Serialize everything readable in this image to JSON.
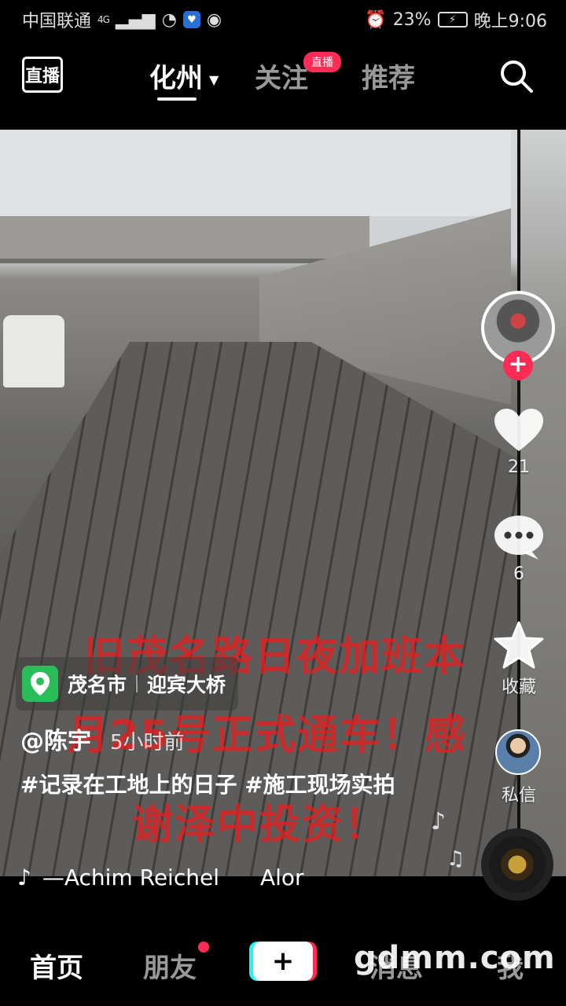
{
  "status_bar": {
    "carrier": "中国联通",
    "network": "4G",
    "battery": "23%",
    "time": "晚上9:06"
  },
  "top_nav": {
    "logo_label": "直播",
    "tabs": [
      {
        "label": "化州",
        "active": true
      },
      {
        "label": "关注",
        "active": false,
        "badge": "直播"
      },
      {
        "label": "推荐",
        "active": false
      }
    ]
  },
  "video": {
    "overlay_lines": [
      "旧茂名路日夜加班本",
      "月25号正式通车！感",
      "谢泽中投资！"
    ]
  },
  "actions": {
    "like_count": "21",
    "comment_count": "6",
    "favorite_label": "收藏",
    "dm_label": "私信"
  },
  "location": {
    "city": "茂名市",
    "place": "迎宾大桥"
  },
  "post": {
    "author": "@陈宇",
    "time": "5小时前",
    "description": "#记录在工地上的日子 #施工现场实拍"
  },
  "music": {
    "artist": "—Achim Reichel",
    "title_fragment": "Alor"
  },
  "bottom_nav": {
    "home": "首页",
    "friends": "朋友",
    "create": "+",
    "messages": "消息",
    "me": "我"
  },
  "watermark": "gdmm.com",
  "colors": {
    "accent": "#fe2c55",
    "location_green": "#2bbd5a"
  }
}
